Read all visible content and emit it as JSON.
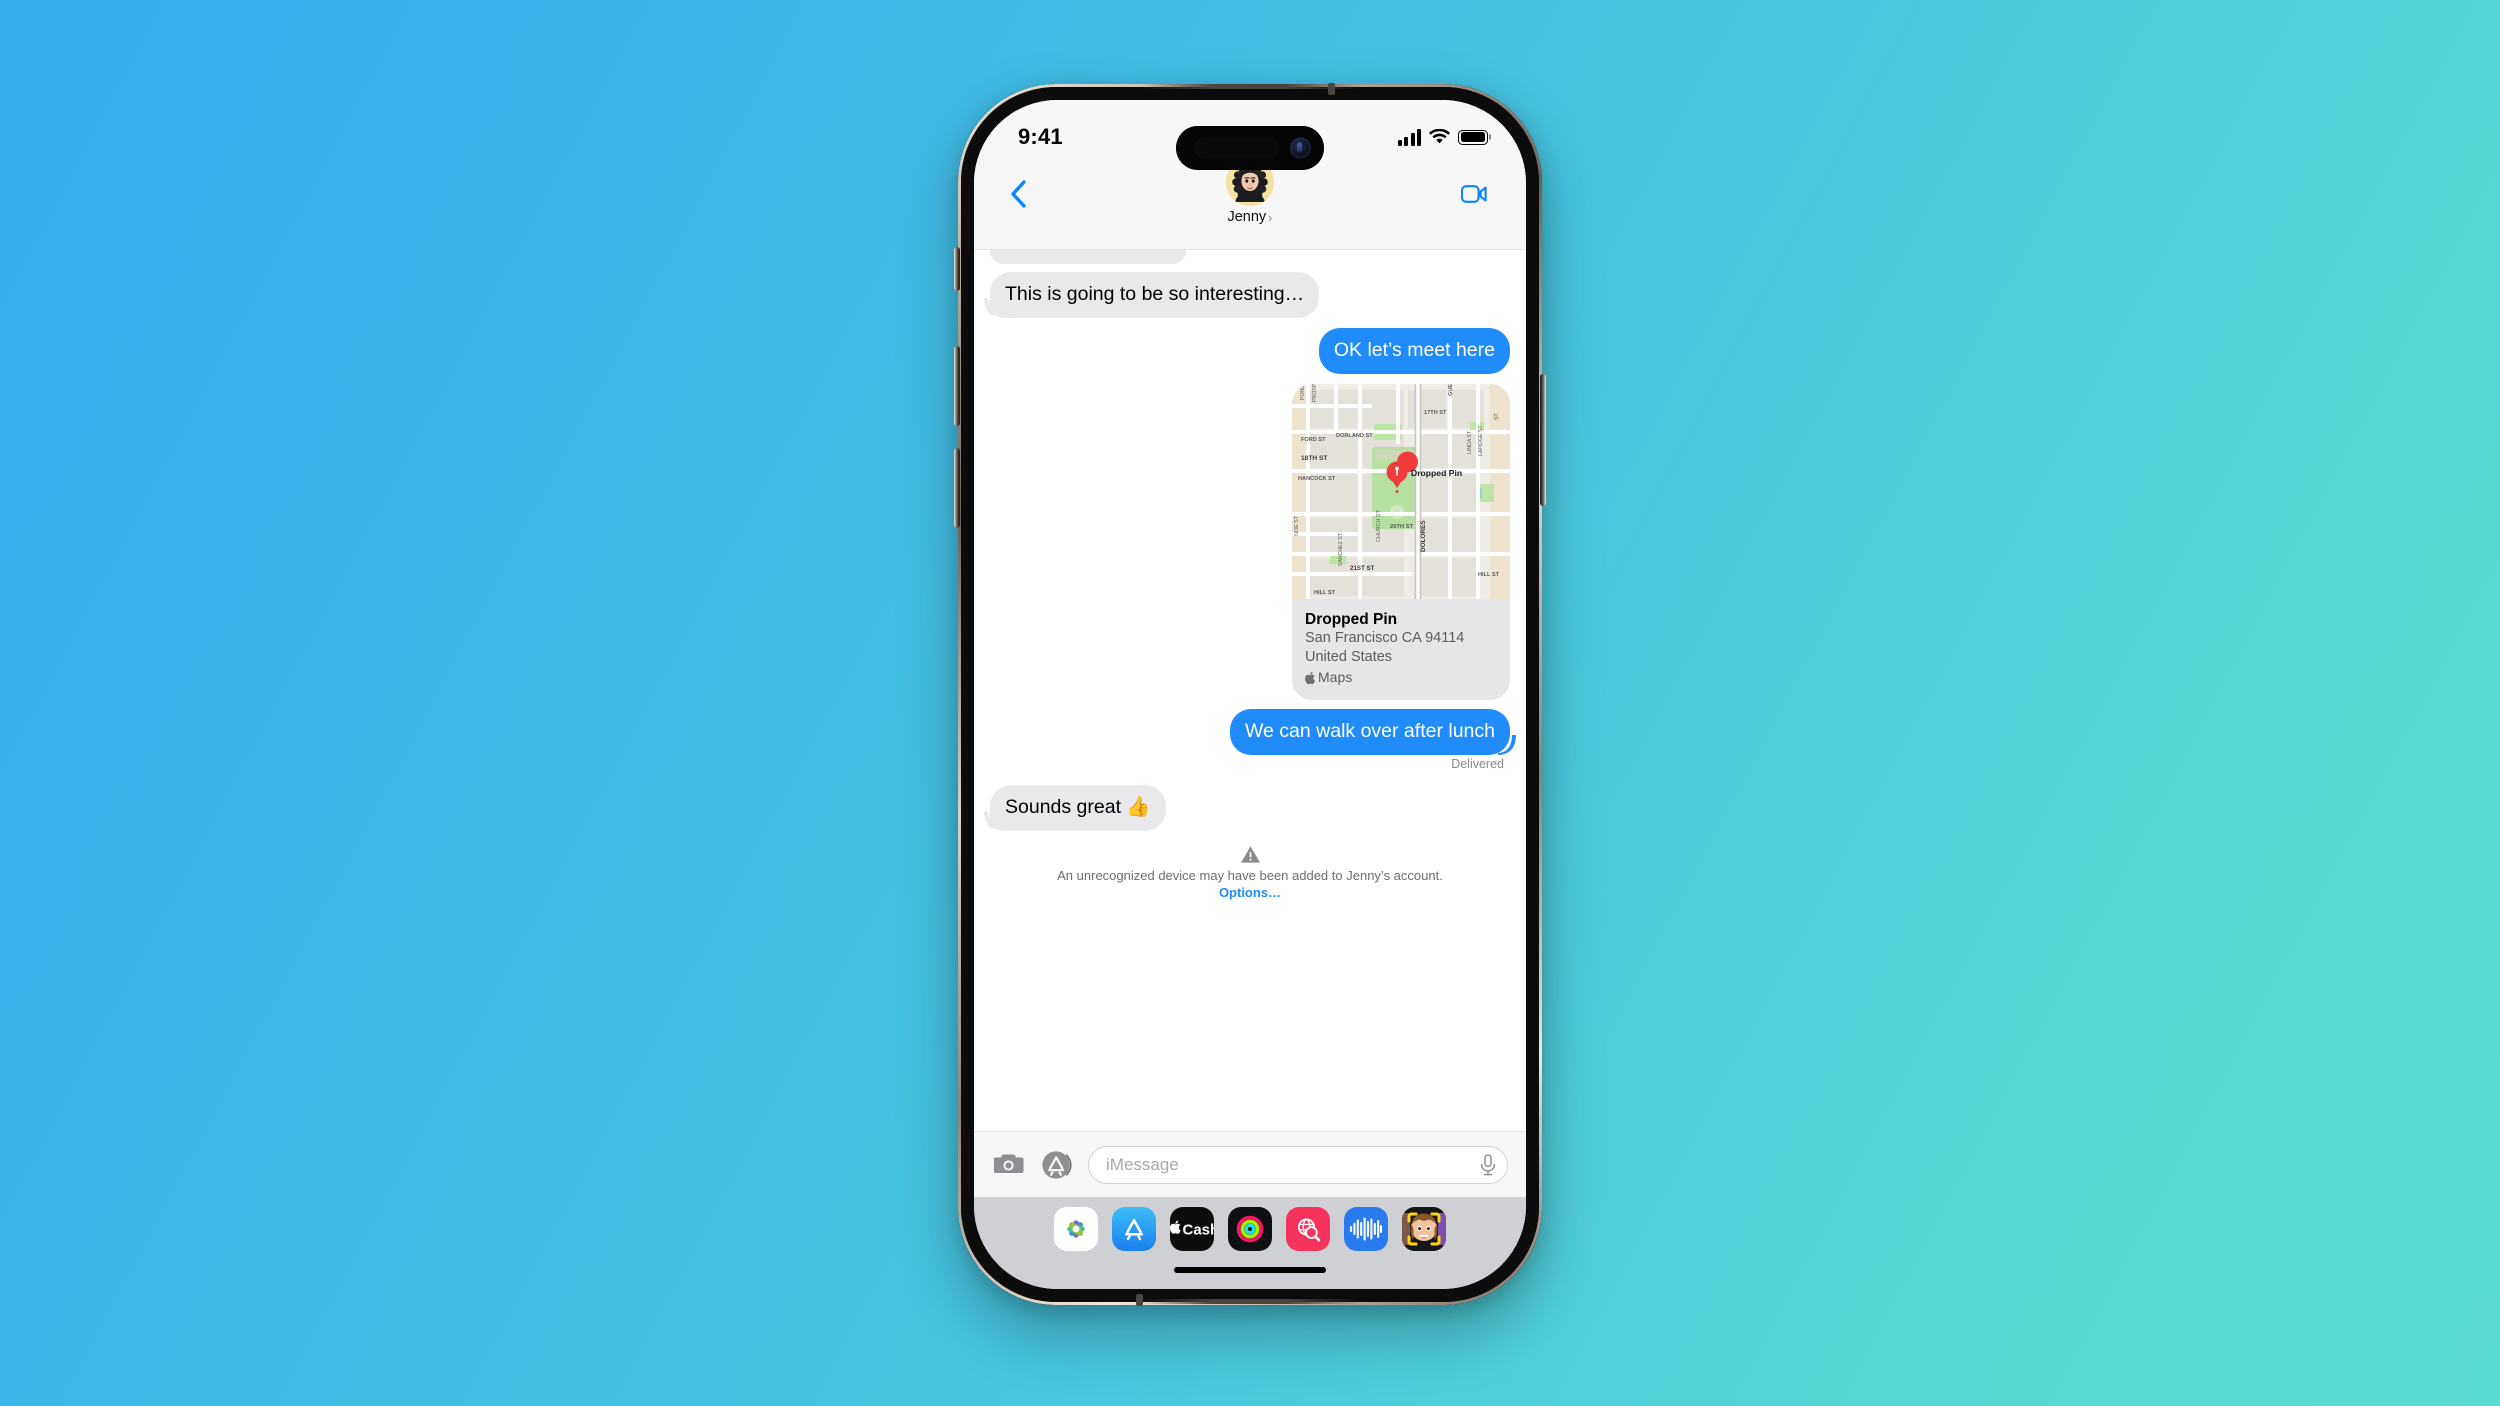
{
  "theme": {
    "bg_gradient_start": "#35aeee",
    "bg_gradient_end": "#5cdbd2",
    "accent_blue": "#1f8cf9",
    "bubble_gray": "#e9e9eb",
    "avatar_bg": "#f6e2a0"
  },
  "status_bar": {
    "time": "9:41",
    "cellular_icon": "signal-bars-icon",
    "wifi_icon": "wifi-icon",
    "battery_icon": "battery-full-icon"
  },
  "nav_bar": {
    "back_icon": "chevron-left-icon",
    "contact_name": "Jenny",
    "disclosure_icon": "chevron-right-icon",
    "avatar_icon": "memoji-avatar",
    "facetime_icon": "video-camera-icon"
  },
  "conversation": {
    "messages": [
      {
        "id": "msg-partial",
        "side": "in",
        "type": "partial",
        "text": ""
      },
      {
        "id": "msg-1",
        "side": "in",
        "type": "text",
        "text": "This is going to be so interesting…",
        "tail": true
      },
      {
        "id": "msg-2",
        "side": "out",
        "type": "text",
        "text": "OK let’s meet here",
        "tail": false
      },
      {
        "id": "msg-3",
        "side": "out",
        "type": "map"
      },
      {
        "id": "msg-4",
        "side": "out",
        "type": "text",
        "text": "We can walk over after lunch",
        "tail": true
      },
      {
        "id": "msg-5",
        "side": "in",
        "type": "text",
        "text": "Sounds great 👍",
        "tail": true
      }
    ],
    "delivery_status": "Delivered",
    "map_card": {
      "title": "Dropped Pin",
      "line2": "San Francisco CA 94114",
      "line3": "United States",
      "provider": "Maps",
      "provider_icon": "apple-logo-icon",
      "pin_label": "Dropped Pin",
      "pin_icon": "map-pin-icon",
      "street_labels": [
        "PROSPER ST",
        "POND ST",
        "FORD ST",
        "DORLAND ST",
        "17TH ST",
        "GUERRERO ST",
        "18TH ST",
        "HANCOCK ST",
        "LAPIDGE ST",
        "LINDA ST",
        "NOE ST",
        "20TH ST",
        "CHURCH ST",
        "SANCHEZ ST",
        "21ST ST",
        "DOLORES",
        "HILL ST"
      ]
    },
    "system_notice": {
      "icon": "warning-triangle-icon",
      "text_before": "An unrecognized device may have been added to Jenny’s account. ",
      "link_label": "Options…"
    }
  },
  "input_bar": {
    "camera_icon": "camera-icon",
    "apps_icon": "app-store-icon",
    "placeholder": "iMessage",
    "value": "",
    "mic_icon": "microphone-icon"
  },
  "app_drawer": {
    "apps": [
      {
        "id": "photos",
        "icon": "photos-icon",
        "label": "Photos"
      },
      {
        "id": "app-store",
        "icon": "app-store-icon",
        "label": "App Store"
      },
      {
        "id": "apple-cash",
        "icon": "apple-cash-icon",
        "label": "Apple Cash"
      },
      {
        "id": "fitness",
        "icon": "activity-rings-icon",
        "label": "Fitness"
      },
      {
        "id": "images",
        "icon": "images-search-icon",
        "label": "#images"
      },
      {
        "id": "digital-touch",
        "icon": "audio-wave-icon",
        "label": "Digital Touch"
      },
      {
        "id": "memoji",
        "icon": "memoji-stickers-icon",
        "label": "Memoji Stickers"
      }
    ],
    "apple_cash_label": "Cash"
  },
  "home_indicator": {
    "icon": "home-indicator"
  }
}
